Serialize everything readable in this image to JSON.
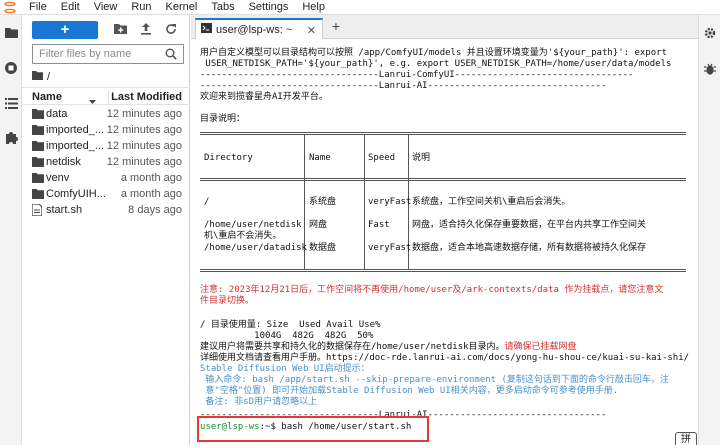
{
  "menubar": {
    "items": [
      "File",
      "Edit",
      "View",
      "Run",
      "Kernel",
      "Tabs",
      "Settings",
      "Help"
    ]
  },
  "filebrowser": {
    "new_label": "+",
    "search_placeholder": "Filter files by name",
    "breadcrumb": "/",
    "col_name": "Name",
    "col_modified": "Last Modified",
    "files": [
      {
        "name": "data",
        "type": "folder",
        "modified": "12 minutes ago"
      },
      {
        "name": "imported_...",
        "type": "folder",
        "modified": "12 minutes ago"
      },
      {
        "name": "imported_...",
        "type": "folder",
        "modified": "12 minutes ago"
      },
      {
        "name": "netdisk",
        "type": "folder",
        "modified": "12 minutes ago"
      },
      {
        "name": "venv",
        "type": "folder",
        "modified": "a month ago"
      },
      {
        "name": "ComfyUIH...",
        "type": "folder",
        "modified": "a month ago"
      },
      {
        "name": "start.sh",
        "type": "file",
        "modified": "8 days ago"
      }
    ]
  },
  "tabs": {
    "terminal_title": "user@lsp-ws: ~",
    "add_label": "+"
  },
  "terminal": {
    "line1": "用户自定义模型可以目录结构可以按照 /app/ComfyUI/models 并且设置环境变量为'${your_path}': export",
    "line2": " USER_NETDISK_PATH='${your_path}', e.g. export USER_NETDISK_PATH=/home/user/data/models",
    "line3": "---------------------------------Lanrui-ComfyUI---------------------------------",
    "line4": "---------------------------------Lanrui-AI---------------------------------",
    "line5": "欢迎来到揽睿星舟AI开发平台。",
    "line6": "目录说明：",
    "table": {
      "h_dir": "Directory",
      "h_name": "Name",
      "h_speed": "Speed",
      "h_desc": "说明",
      "r1_dir": "/",
      "r1_name": "系统盘",
      "r1_speed": "veryFast",
      "r1_desc": "系统盘，工作空间关机\\重启后会消失。",
      "r2_dir": "/home/user/netdisk",
      "r2_name": "网盘",
      "r2_speed": "Fast",
      "r2_desc": "网盘，适合持久化保存重要数据，在平台内共享工作空间关",
      "r2_desc2": "机\\重启不会消失。",
      "r3_dir": "/home/user/datadisk",
      "r3_name": "数据盘",
      "r3_speed": "veryFast",
      "r3_desc": "数据盘，适合本地高速数据存储，所有数据将被持久化保存"
    },
    "notice1": "注意: 2023年12月21日后，工作空间将不再使用/home/user及/ark-contexts/data 作为挂载点，请您注意文",
    "notice2": "件目录切换。",
    "disk1": "/ 目录使用量: Size  Used Avail Use%",
    "disk2": "          1004G  482G  482G  50%",
    "advice_a": "建议用户将需要共享和持久化的数据保存在/home/user/netdisk目录内。",
    "advice_b": "请确保已挂载网盘",
    "doc": "详细使用文档请查看用户手册。https://doc-rde.lanrui-ai.com/docs/yong-hu-shou-ce/kuai-su-kai-shi/",
    "sd1": "Stable Diffusion Web UI启动提示：",
    "sd2": " 输入命令: bash /app/start.sh --skip-prepare-environment (复制这句话到下面的命令行敲击回车，注",
    "sd3": " 意\"空格\"位置) 即可开始加载Stable Diffusion Web UI相关内容，更多启动命令可参考使用手册.",
    "sd4": " 备注: 非sD用户请忽略以上",
    "line_end": "---------------------------------Lanrui-AI---------------------------------",
    "prompt_user": "user@lsp-ws",
    "prompt_rest": ":~$ bash /home/user/start.sh"
  },
  "ime_badge": "拼",
  "colors": {
    "accent": "#1976d2",
    "error": "#d32f2f",
    "info": "#4a90c8",
    "prompt": "#1a8f2e",
    "highlight": "#e53935"
  }
}
